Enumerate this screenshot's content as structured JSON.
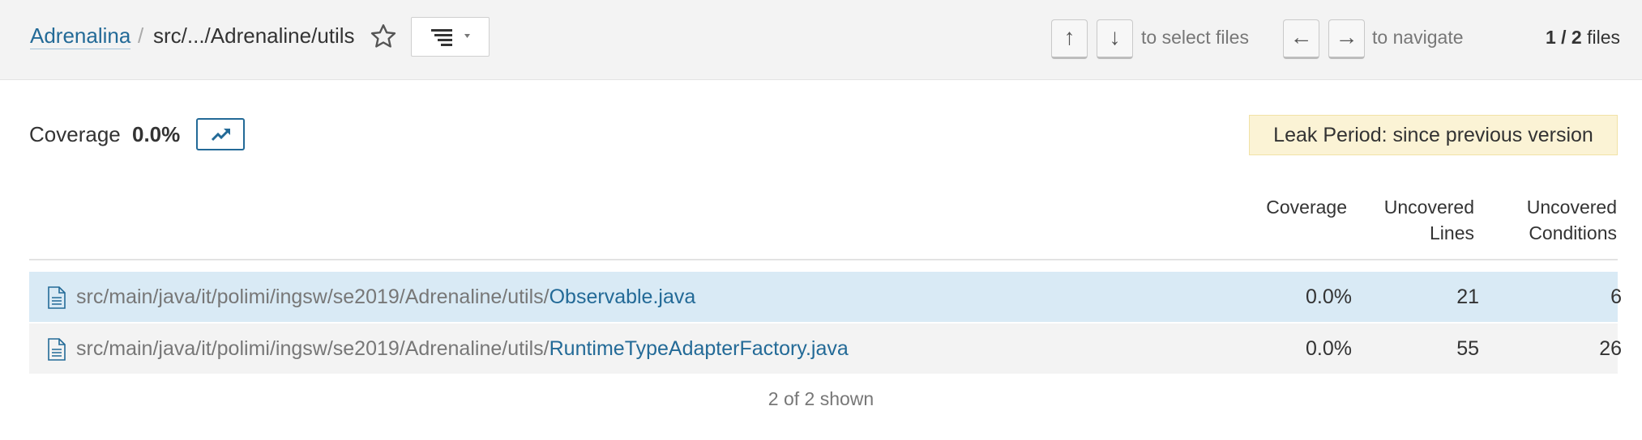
{
  "breadcrumb": {
    "project": "Adrenalina",
    "separator": "/",
    "path": "src/.../Adrenaline/utils"
  },
  "toolbar": {
    "favorite_icon": "star-outline-icon",
    "view_mode_icon": "tree-list-icon",
    "select_keys": [
      "↑",
      "↓"
    ],
    "select_hint": "to select files",
    "navigate_keys": [
      "←",
      "→"
    ],
    "navigate_hint": "to navigate",
    "files_current": "1 / 2",
    "files_label": "files"
  },
  "summary": {
    "label": "Coverage",
    "value": "0.0%",
    "history_icon": "trend-chart-icon",
    "leak_period": "Leak Period: since previous version"
  },
  "table": {
    "columns": [
      [
        "Coverage"
      ],
      [
        "Uncovered",
        "Lines"
      ],
      [
        "Uncovered",
        "Conditions"
      ]
    ],
    "rows": [
      {
        "dir": "src/main/java/it/polimi/ingsw/se2019/Adrenaline/utils/",
        "name": "Observable.java",
        "coverage": "0.0%",
        "uncovered_lines": "21",
        "uncovered_conditions": "6",
        "selected": true
      },
      {
        "dir": "src/main/java/it/polimi/ingsw/se2019/Adrenaline/utils/",
        "name": "RuntimeTypeAdapterFactory.java",
        "coverage": "0.0%",
        "uncovered_lines": "55",
        "uncovered_conditions": "26",
        "selected": false
      }
    ],
    "footer": "2 of 2 shown"
  },
  "colors": {
    "link": "#236a97",
    "selected_row": "#d9eaf5",
    "leak_background": "#fbf3d5",
    "muted_text": "#777777"
  }
}
